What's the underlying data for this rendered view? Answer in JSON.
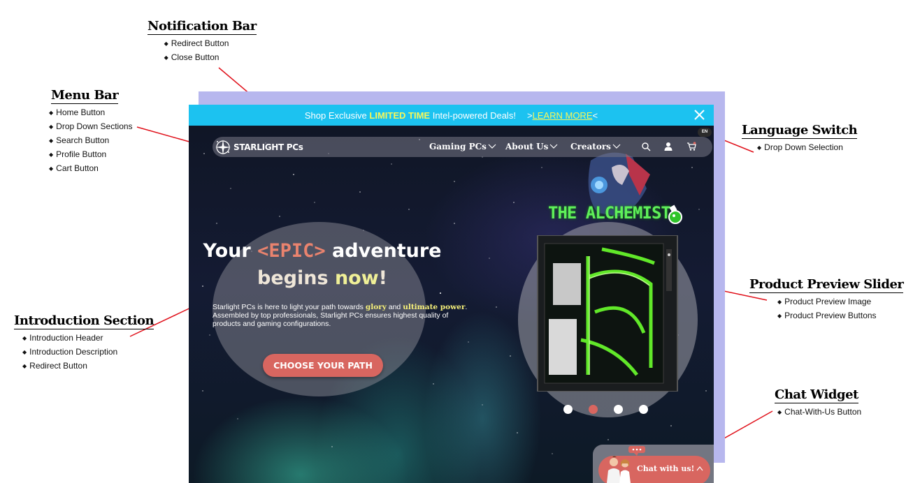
{
  "annotations": {
    "notification_bar": {
      "title": "Notification Bar",
      "items": [
        "Redirect Button",
        "Close Button"
      ]
    },
    "menu_bar": {
      "title": "Menu Bar",
      "items": [
        "Home Button",
        "Drop Down Sections",
        "Search Button",
        "Profile Button",
        "Cart Button"
      ]
    },
    "language_switch": {
      "title": "Language Switch",
      "items": [
        "Drop Down Selection"
      ]
    },
    "introduction_section": {
      "title": "Introduction Section",
      "items": [
        "Introduction Header",
        "Introduction Description",
        "Redirect Button"
      ]
    },
    "product_preview_slider": {
      "title": "Product Preview Slider",
      "items": [
        "Product Preview Image",
        "Product Preview Buttons"
      ]
    },
    "chat_widget": {
      "title": "Chat Widget",
      "items": [
        "Chat-With-Us Button"
      ]
    }
  },
  "notification": {
    "prefix": "Shop Exclusive",
    "highlight": "LIMITED TIME",
    "suffix": "Intel-powered Deals!",
    "link_open": ">",
    "link_label": "LEARN MORE",
    "link_close": "<",
    "close_icon": "close-icon"
  },
  "language": {
    "selected": "EN"
  },
  "menu": {
    "logo_text": "STARLIGHT PCs",
    "nav": [
      "Gaming PCs",
      "About Us",
      "Creators"
    ],
    "icons": [
      "search-icon",
      "profile-icon",
      "cart-icon"
    ]
  },
  "intro": {
    "title_line1_a": "Your",
    "title_epic": "<EPIC>",
    "title_line1_b": "adventure",
    "title_line2_a": "begins",
    "title_now": "now",
    "title_bang": "!",
    "desc_a": "Starlight PCs is here to light your path towards",
    "desc_glory": "glory",
    "desc_and": "and",
    "desc_power": "ultimate power",
    "desc_b": ". Assembled by top professionals, Starlight PCs ensures highest quality of products and gaming configurations.",
    "cta": "CHOOSE YOUR PATH"
  },
  "product": {
    "name": "THE ALCHEMIST",
    "slides": 4,
    "active_slide": 2
  },
  "chat": {
    "label": "Chat with us!"
  },
  "colors": {
    "notif_bg": "#1cc2f0",
    "accent_yellow": "#f7f75a",
    "accent_red": "#d86660",
    "alchemist_green": "#5ff05a",
    "callout_line": "#e0101a",
    "shadow_block": "#b7b7ee"
  }
}
